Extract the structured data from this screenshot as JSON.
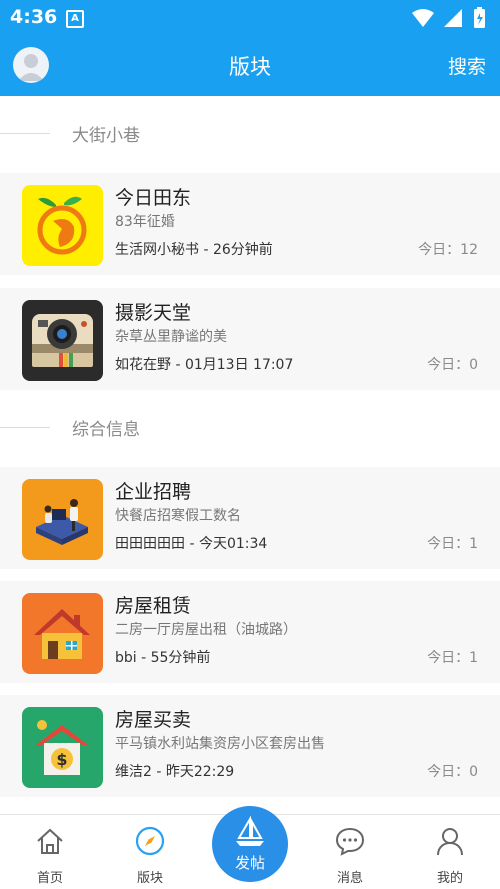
{
  "status_bar": {
    "time": "4:36",
    "notification_glyph": "A"
  },
  "header": {
    "title": "版块",
    "search_label": "搜索"
  },
  "sections": [
    {
      "title": "大街小巷",
      "forums": [
        {
          "name": "今日田东",
          "description": "83年征婚",
          "meta": "生活网小秘书 - 26分钟前",
          "today": "今日：12",
          "icon": "mango-icon",
          "color": "#ffee00"
        },
        {
          "name": "摄影天堂",
          "description": "杂草丛里静谧的美",
          "meta": "如花在野 - 01月13日 17:07",
          "today": "今日：0",
          "icon": "camera-icon",
          "color": "#2b2b2b"
        }
      ]
    },
    {
      "title": "综合信息",
      "forums": [
        {
          "name": "企业招聘",
          "description": "快餐店招寒假工数名",
          "meta": "田田田田田 - 今天01:34",
          "today": "今日：1",
          "icon": "office-desk-icon",
          "color": "#f39a1c"
        },
        {
          "name": "房屋租赁",
          "description": "二房一厅房屋出租（油城路）",
          "meta": "bbi - 55分钟前",
          "today": "今日：1",
          "icon": "house-icon",
          "color": "#f3772b"
        },
        {
          "name": "房屋买卖",
          "description": "平马镇水利站集资房小区套房出售",
          "meta": "维洁2 - 昨天22:29",
          "today": "今日：0",
          "icon": "house-dollar-icon",
          "color": "#27a66b"
        }
      ]
    }
  ],
  "tabs": [
    {
      "label": "首页",
      "icon": "home-icon"
    },
    {
      "label": "版块",
      "icon": "compass-icon",
      "active": true
    },
    {
      "label": "发帖",
      "icon": "sailboat-icon"
    },
    {
      "label": "消息",
      "icon": "chat-bubble-icon"
    },
    {
      "label": "我的",
      "icon": "person-icon"
    }
  ],
  "colors": {
    "primary": "#1aa0f0",
    "post_button": "#2a8fe6"
  }
}
